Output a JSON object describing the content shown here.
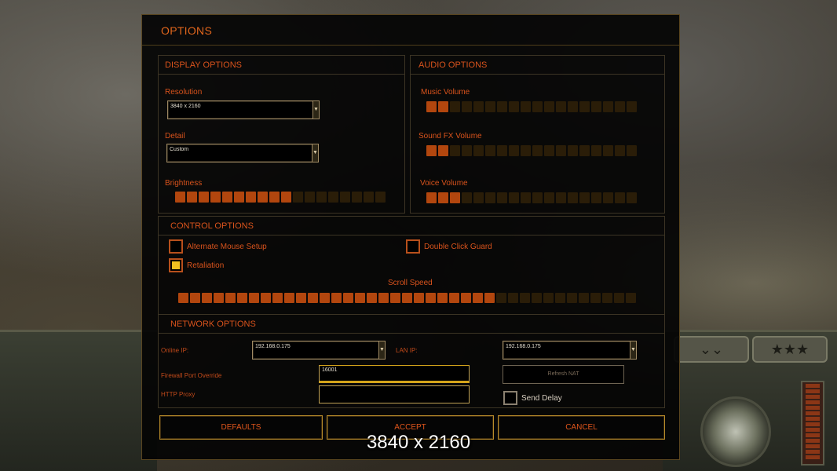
{
  "window": {
    "title": "OPTIONS"
  },
  "display": {
    "header": "DISPLAY OPTIONS",
    "resolution_label": "Resolution",
    "resolution_value": "3840 x 2160",
    "detail_label": "Detail",
    "detail_value": "Custom",
    "brightness_label": "Brightness",
    "brightness_level": 10,
    "brightness_segments": 18
  },
  "audio": {
    "header": "AUDIO OPTIONS",
    "music_label": "Music Volume",
    "music_level": 2,
    "sfx_label": "Sound FX Volume",
    "sfx_level": 2,
    "voice_label": "Voice Volume",
    "voice_level": 3,
    "segments": 18
  },
  "control": {
    "header": "CONTROL OPTIONS",
    "alternate_mouse_label": "Alternate Mouse Setup",
    "alternate_mouse_checked": false,
    "double_click_label": "Double Click Guard",
    "double_click_checked": false,
    "retaliation_label": "Retaliation",
    "retaliation_checked": true,
    "scroll_speed_label": "Scroll Speed",
    "scroll_level": 27,
    "scroll_segments": 39
  },
  "network": {
    "header": "NETWORK OPTIONS",
    "online_ip_label": "Online IP:",
    "online_ip_value": "192.168.0.175",
    "lan_ip_label": "LAN IP:",
    "lan_ip_value": "192.168.0.175",
    "firewall_label": "Firewall Port Override",
    "firewall_value": "16001",
    "http_proxy_label": "HTTP Proxy",
    "http_proxy_value": "",
    "refresh_nat_label": "Refresh NAT",
    "send_delay_label": "Send Delay",
    "send_delay_checked": false
  },
  "buttons": {
    "defaults": "DEFAULTS",
    "accept": "ACCEPT",
    "cancel": "CANCEL"
  },
  "overlay": {
    "resolution_text": "3840 x 2160"
  },
  "colors": {
    "accent_orange": "#d9531c",
    "slider_on": "#b2460e",
    "slider_off": "#2a1d08",
    "check_fill": "#f2c020"
  }
}
